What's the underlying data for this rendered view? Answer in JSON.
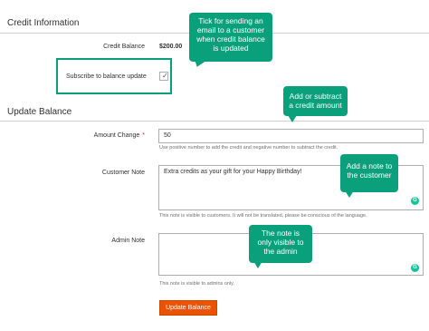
{
  "credit_information": {
    "title": "Credit Information",
    "balance_label": "Credit Balance",
    "balance_value": "$200.00",
    "subscribe_label": "Subscribe to balance update",
    "subscribe_checked": true
  },
  "update_balance": {
    "title": "Update Balance",
    "amount": {
      "label": "Amount Change",
      "required_mark": "*",
      "value": "50",
      "note": "Use positive number to add the credit and negative number to subtract the credit."
    },
    "customer_note": {
      "label": "Customer Note",
      "value": "Extra credits as your gift for your Happy Birthday!",
      "note": "This note is visible to customers. It will not be translated, please be conscious of the language."
    },
    "admin_note": {
      "label": "Admin Note",
      "value": "",
      "note": "This note is visible to admins only."
    },
    "submit_label": "Update Balance"
  },
  "callouts": {
    "subscribe": [
      "Tick for sending an",
      "email to a customer",
      "when credit balance",
      "is updated"
    ],
    "amount": [
      "Add or subtract",
      "a credit amount"
    ],
    "customer_note": [
      "Add a note to",
      "the customer"
    ],
    "admin_note": [
      "The note is",
      "only visible to",
      "the admin"
    ]
  },
  "colors": {
    "accent": "#0aa07b",
    "button": "#eb5202",
    "required": "#e22626",
    "grammarly": "#15c39a"
  },
  "icons": {
    "checkbox_tick": "✓",
    "grammarly_letter": "G"
  }
}
